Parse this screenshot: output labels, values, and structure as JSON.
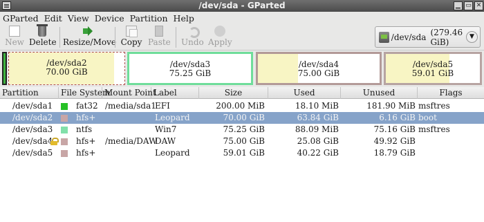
{
  "window": {
    "title": "/dev/sda - GParted"
  },
  "menu": [
    "GParted",
    "Edit",
    "View",
    "Device",
    "Partition",
    "Help"
  ],
  "toolbar": {
    "new": "New",
    "delete": "Delete",
    "resize": "Resize/Move",
    "copy": "Copy",
    "paste": "Paste",
    "undo": "Undo",
    "apply": "Apply"
  },
  "device": {
    "label": "/dev/sda",
    "size": "(279.46 GiB)"
  },
  "map": [
    {
      "name": "/dev/sda2",
      "size": "70.00 GiB",
      "used_fraction": 0.91,
      "border": "#b9a6a0"
    },
    {
      "name": "/dev/sda3",
      "size": "75.25 GiB",
      "used_fraction": 0.0,
      "border": "#6fdd9a"
    },
    {
      "name": "/dev/sda4",
      "size": "75.00 GiB",
      "used_fraction": 0.33,
      "border": "#b39a98"
    },
    {
      "name": "/dev/sda5",
      "size": "59.01 GiB",
      "used_fraction": 0.68,
      "border": "#b7a4a2"
    }
  ],
  "columns": {
    "partition": "Partition",
    "filesystem": "File System",
    "mount": "Mount Point",
    "label": "Label",
    "size": "Size",
    "used": "Used",
    "unused": "Unused",
    "flags": "Flags"
  },
  "rows": [
    {
      "partition": "/dev/sda1",
      "fs": "fat32",
      "fs_color": "#26c126",
      "mount": "/media/sda1",
      "label": "EFI",
      "size": "200.00 MiB",
      "used": "18.10 MiB",
      "unused": "181.90 MiB",
      "flags": "msftres",
      "locked": false
    },
    {
      "partition": "/dev/sda2",
      "fs": "hfs+",
      "fs_color": "#c8a6a6",
      "mount": "",
      "label": "Leopard",
      "size": "70.00 GiB",
      "used": "63.84 GiB",
      "unused": "6.16 GiB",
      "flags": "boot",
      "locked": false
    },
    {
      "partition": "/dev/sda3",
      "fs": "ntfs",
      "fs_color": "#82e0aa",
      "mount": "",
      "label": "Win7",
      "size": "75.25 GiB",
      "used": "88.09 MiB",
      "unused": "75.16 GiB",
      "flags": "msftres",
      "locked": false
    },
    {
      "partition": "/dev/sda4",
      "fs": "hfs+",
      "fs_color": "#c8a6a6",
      "mount": "/media/DAW",
      "label": "DAW",
      "size": "75.00 GiB",
      "used": "25.08 GiB",
      "unused": "49.92 GiB",
      "flags": "",
      "locked": true
    },
    {
      "partition": "/dev/sda5",
      "fs": "hfs+",
      "fs_color": "#c8a6a6",
      "mount": "",
      "label": "Leopard",
      "size": "59.01 GiB",
      "used": "40.22 GiB",
      "unused": "18.79 GiB",
      "flags": "",
      "locked": false
    }
  ]
}
